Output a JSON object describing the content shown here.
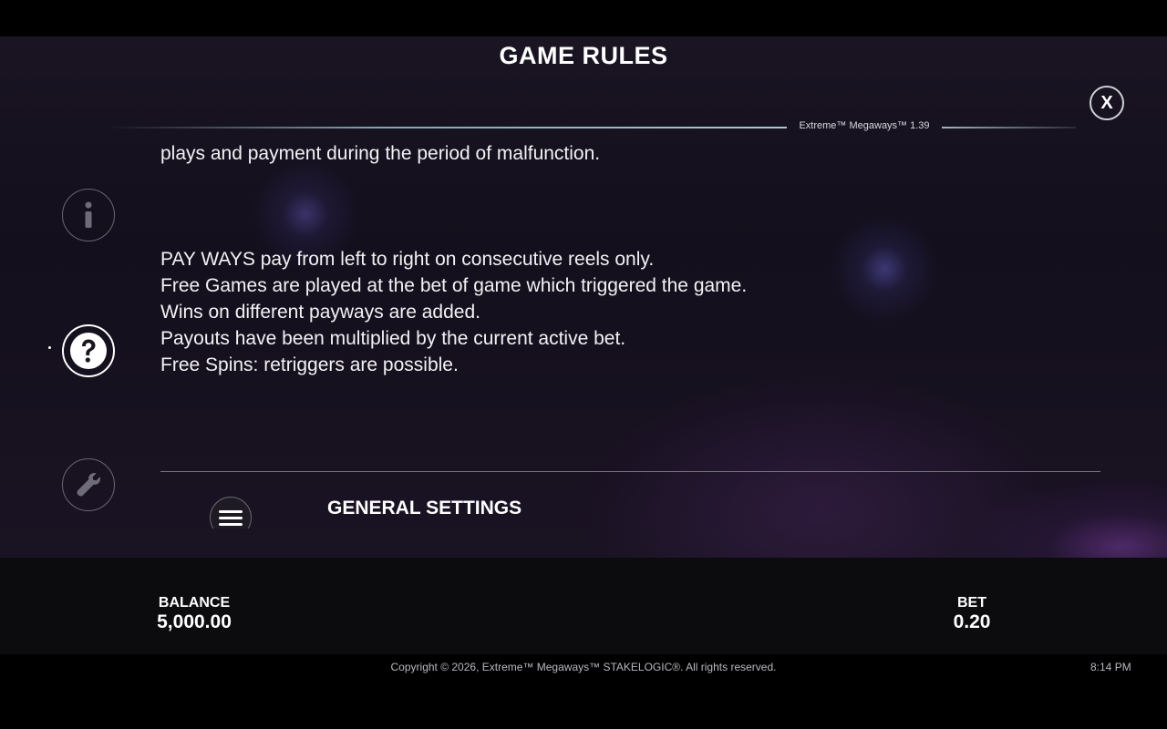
{
  "header": {
    "title": "GAME RULES",
    "version": "Extreme™ Megaways™ 1.39",
    "close_label": "X"
  },
  "content": {
    "partial_line": "plays and payment during the period of malfunction.",
    "rules": [
      "PAY WAYS pay from left to right on consecutive reels only.",
      "Free Games are played at the bet of game which triggered the game.",
      "Wins on different payways are added.",
      "Payouts have been multiplied by the current active bet.",
      "Free Spins: retriggers are possible."
    ],
    "next_section": "GENERAL SETTINGS"
  },
  "sidebar": {
    "items": [
      {
        "icon": "info-icon",
        "active": false
      },
      {
        "icon": "question-icon",
        "active": true
      },
      {
        "icon": "wrench-icon",
        "active": false
      }
    ]
  },
  "status": {
    "balance_label": "BALANCE",
    "balance_value": "5,000.00",
    "bet_label": "BET",
    "bet_value": "0.20"
  },
  "footer": {
    "copyright": "Copyright © 2026, Extreme™ Megaways™ STAKELOGIC®. All rights reserved.",
    "time": "8:14 PM"
  },
  "colors": {
    "accent_line": "#b4d2dc",
    "panel_bg": "#15111d",
    "bar_bg": "#0c0b0e"
  }
}
